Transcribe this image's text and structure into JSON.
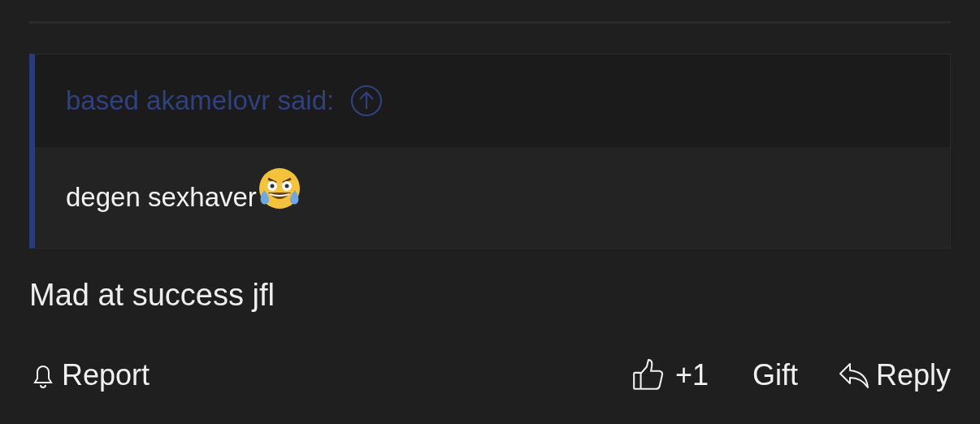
{
  "quote": {
    "author_line": "based akamelovr said:",
    "body": "degen sexhaver"
  },
  "message": "Mad at success jfl",
  "actions": {
    "report": "Report",
    "like": "+1",
    "gift": "Gift",
    "reply": "Reply"
  }
}
